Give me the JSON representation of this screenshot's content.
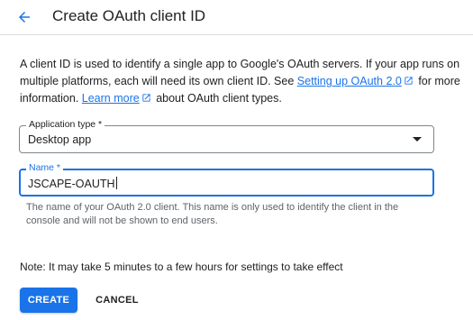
{
  "header": {
    "title": "Create OAuth client ID"
  },
  "intro": {
    "text_1": "A client ID is used to identify a single app to Google's OAuth servers. If your app runs on multiple platforms, each will need its own client ID. See ",
    "link_setup": "Setting up OAuth 2.0",
    "text_2": " for more information. ",
    "link_learn": "Learn more",
    "text_3": " about OAuth client types."
  },
  "application_type": {
    "label": "Application type *",
    "value": "Desktop app"
  },
  "name_field": {
    "label": "Name *",
    "value": "JSCAPE-OAUTH",
    "helper": "The name of your OAuth 2.0 client. This name is only used to identify the client in the console and will not be shown to end users."
  },
  "note": "Note: It may take 5 minutes to a few hours for settings to take effect",
  "actions": {
    "create": "CREATE",
    "cancel": "CANCEL"
  },
  "colors": {
    "accent": "#1a73e8",
    "text": "#202124",
    "muted": "#5f6368"
  },
  "icons": {
    "back": "arrow-back-icon",
    "external": "open-in-new-icon",
    "dropdown": "arrow-drop-down-icon"
  }
}
